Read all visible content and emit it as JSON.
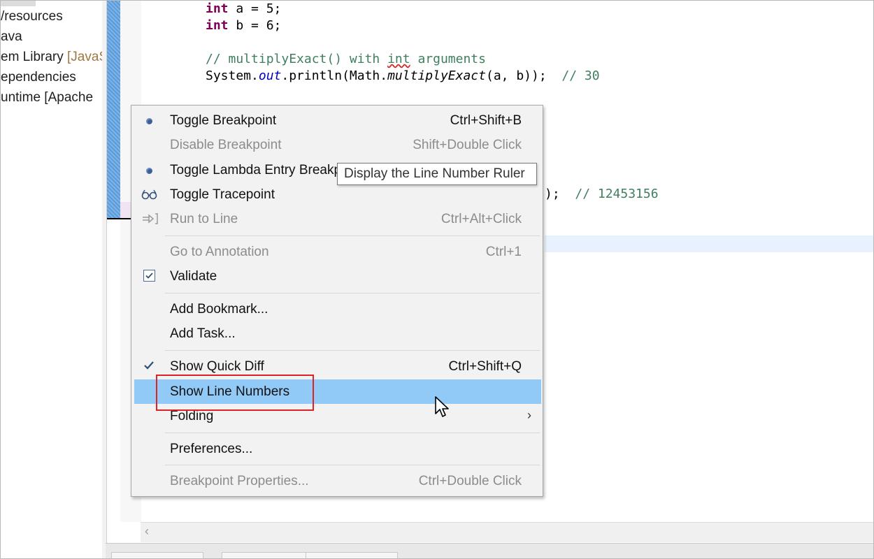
{
  "explorer": {
    "items": [
      "/resources",
      "ava",
      "em Library ",
      "ependencies",
      "untime [Apache "
    ],
    "jre_decoration": "[JavaS"
  },
  "code": {
    "line1": "int a = 5;",
    "line2": "int b = 6;",
    "comment1": "// multiplyExact() with int arguments",
    "println1": "System.out.println(Math.multiplyExact(a, b));  // 30",
    "partial": ");  // 12453156"
  },
  "context_menu": {
    "items": [
      {
        "label": "Toggle Breakpoint",
        "accel": "Ctrl+Shift+B",
        "icon": "breakpoint-dot-icon",
        "enabled": true
      },
      {
        "label": "Disable Breakpoint",
        "accel": "Shift+Double Click",
        "icon": "",
        "enabled": false
      },
      {
        "label": "Toggle Lambda Entry Breakpoint",
        "accel": "",
        "icon": "breakpoint-dot-icon",
        "enabled": true
      },
      {
        "label": "Toggle Tracepoint",
        "accel": "",
        "icon": "glasses-icon",
        "enabled": true
      },
      {
        "label": "Run to Line",
        "accel": "Ctrl+Alt+Click",
        "icon": "run-to-line-icon",
        "enabled": false
      },
      {
        "label": "Go to Annotation",
        "accel": "Ctrl+1",
        "icon": "",
        "enabled": false
      },
      {
        "label": "Validate",
        "accel": "",
        "icon": "checkbox-icon",
        "enabled": true
      },
      {
        "label": "Add Bookmark...",
        "accel": "",
        "icon": "",
        "enabled": true
      },
      {
        "label": "Add Task...",
        "accel": "",
        "icon": "",
        "enabled": true
      },
      {
        "label": "Show Quick Diff",
        "accel": "Ctrl+Shift+Q",
        "icon": "checkmark-icon",
        "enabled": true
      },
      {
        "label": "Show Line Numbers",
        "accel": "",
        "icon": "",
        "enabled": true,
        "highlighted": true
      },
      {
        "label": "Folding",
        "accel": "",
        "icon": "",
        "enabled": true,
        "submenu": true
      },
      {
        "label": "Preferences...",
        "accel": "",
        "icon": "",
        "enabled": true
      },
      {
        "label": "Breakpoint Properties...",
        "accel": "Ctrl+Double Click",
        "icon": "",
        "enabled": false
      }
    ],
    "submenu_arrow": "›"
  },
  "tooltip": "Display the Line Number Ruler",
  "colors": {
    "highlight": "#91c9f7",
    "annotation_box": "#e02024",
    "keyword": "#7f0055",
    "comment": "#3f7f5f"
  }
}
